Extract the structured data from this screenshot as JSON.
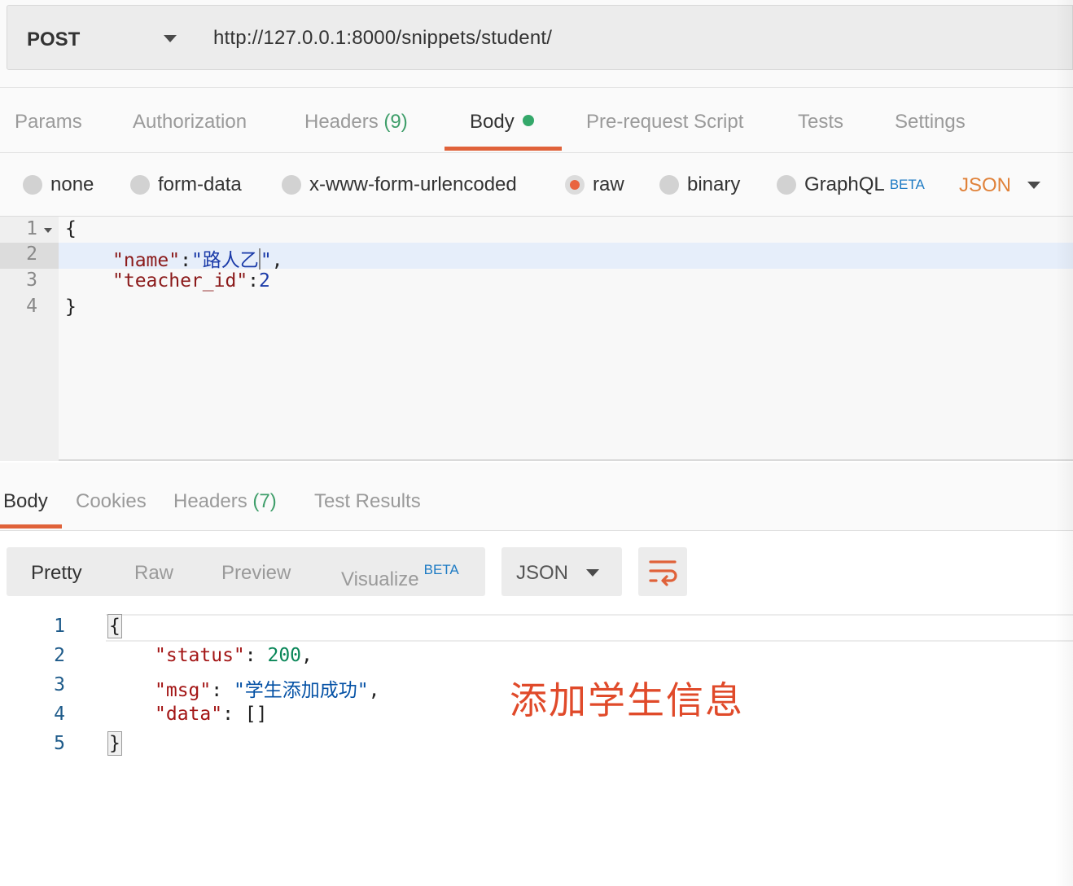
{
  "request": {
    "method": "POST",
    "url": "http://127.0.0.1:8000/snippets/student/"
  },
  "request_tabs": [
    {
      "label": "Params"
    },
    {
      "label": "Authorization"
    },
    {
      "label": "Headers",
      "count": "(9)"
    },
    {
      "label": "Body",
      "active": true
    },
    {
      "label": "Pre-request Script"
    },
    {
      "label": "Tests"
    },
    {
      "label": "Settings"
    }
  ],
  "body_types": {
    "options": [
      "none",
      "form-data",
      "x-www-form-urlencoded",
      "raw",
      "binary",
      "GraphQL"
    ],
    "selected": "raw",
    "graphql_badge": "BETA",
    "format": "JSON"
  },
  "request_body": {
    "line_numbers": [
      "1",
      "2",
      "3",
      "4"
    ],
    "lines": [
      "{",
      "\"name\":\"路人乙\",",
      "\"teacher_id\":2",
      "}"
    ],
    "name_key": "\"name\"",
    "name_value": "\"路人乙",
    "name_value_close": "\"",
    "teacher_key": "\"teacher_id\"",
    "teacher_value": "2"
  },
  "response_tabs": [
    {
      "label": "Body",
      "active": true
    },
    {
      "label": "Cookies"
    },
    {
      "label": "Headers",
      "count": "(7)"
    },
    {
      "label": "Test Results"
    }
  ],
  "response_view": {
    "modes": [
      "Pretty",
      "Raw",
      "Preview",
      "Visualize"
    ],
    "active_mode": "Pretty",
    "visualize_badge": "BETA",
    "format": "JSON"
  },
  "response_body": {
    "line_numbers": [
      "1",
      "2",
      "3",
      "4",
      "5"
    ],
    "status_key": "\"status\"",
    "status_value": "200",
    "msg_key": "\"msg\"",
    "msg_value": "\"学生添加成功\"",
    "data_key": "\"data\"",
    "data_value": "[]"
  },
  "annotation": "添加学生信息",
  "colors": {
    "accent": "#e0623a",
    "active_dot": "#34a86a",
    "beta": "#1e7bc4",
    "annotation": "#e04a2a"
  }
}
